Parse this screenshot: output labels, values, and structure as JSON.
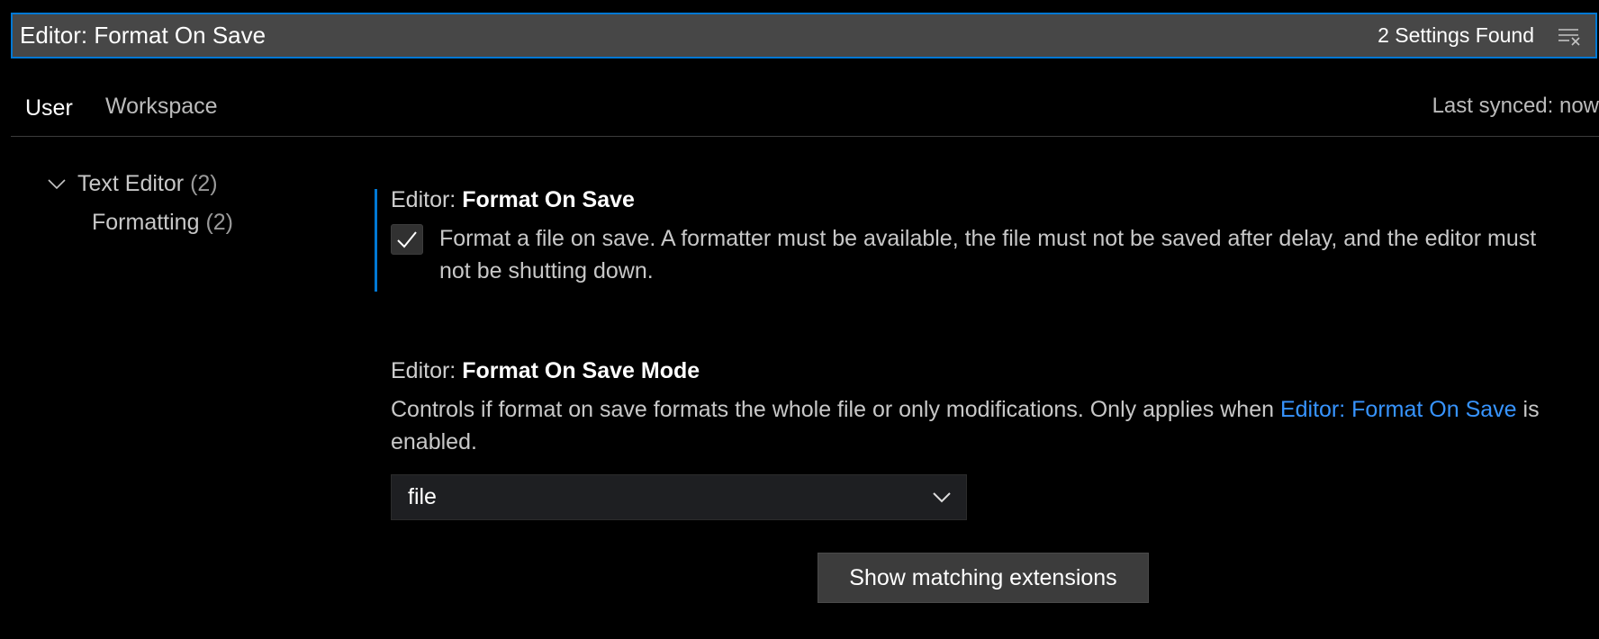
{
  "search": {
    "value": "Editor: Format On Save",
    "result_count": "2 Settings Found",
    "clear_icon": "clear-filter-icon"
  },
  "tabs": {
    "user": "User",
    "workspace": "Workspace",
    "active": "User"
  },
  "sync_status": "Last synced: now",
  "toc": {
    "group_label": "Text Editor",
    "group_count": "(2)",
    "group_icon": "chevron-down-icon",
    "sub_label": "Formatting",
    "sub_count": "(2)"
  },
  "settings": [
    {
      "category": "Editor: ",
      "name": "Format On Save",
      "checked": true,
      "description": "Format a file on save. A formatter must be available, the file must not be saved after delay, and the editor must not be shutting down."
    },
    {
      "category": "Editor: ",
      "name": "Format On Save Mode",
      "description_before": "Controls if format on save formats the whole file or only modifications. Only applies when ",
      "description_link": "Editor: Format On Save",
      "description_after": " is enabled.",
      "selected_value": "file"
    }
  ],
  "buttons": {
    "show_extensions": "Show matching extensions"
  },
  "colors": {
    "accent": "#0078d4",
    "link": "#3794ff",
    "background": "#000000"
  }
}
